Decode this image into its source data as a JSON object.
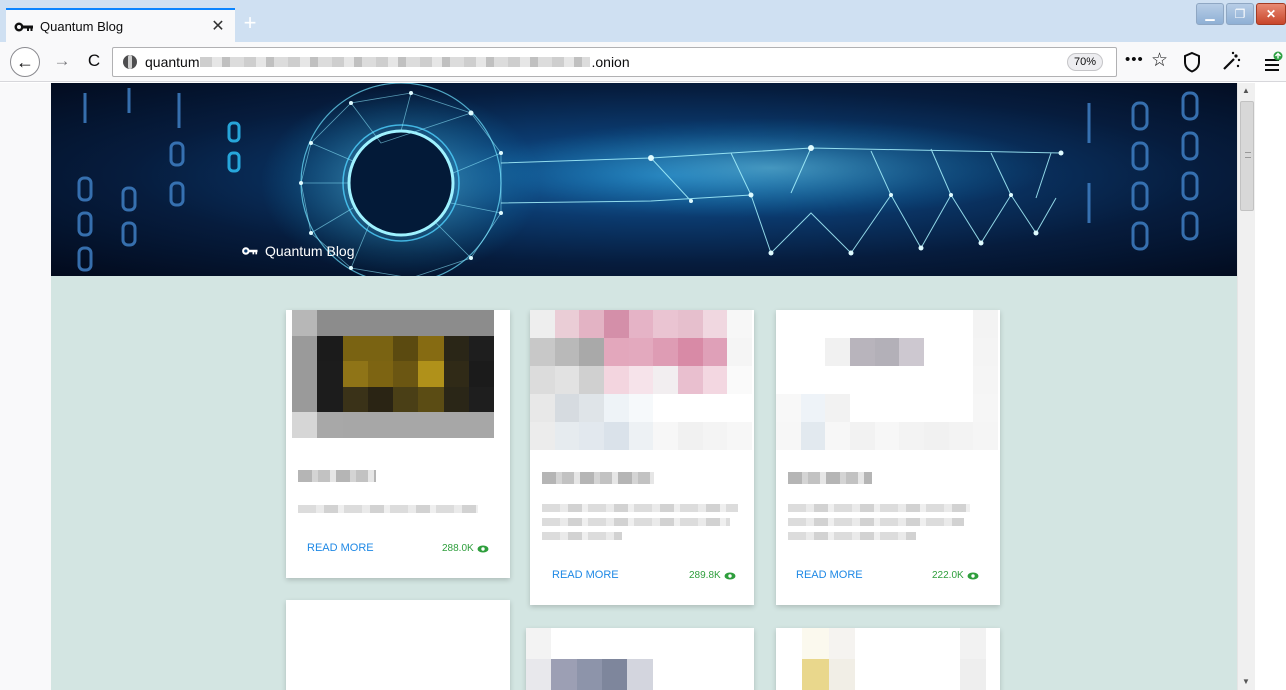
{
  "browser": {
    "tab_title": "Quantum Blog",
    "tab_close": "✕",
    "new_tab": "+",
    "url_prefix": "quantum",
    "url_suffix": ".onion",
    "zoom": "70%",
    "more": "•••",
    "star": "☆",
    "back": "←",
    "forward": "→",
    "reload": "C",
    "window": {
      "minimize": "▁",
      "maximize": "❐",
      "close": "✕"
    },
    "icons": [
      "key-icon",
      "shield-icon",
      "tor-icon",
      "menu-icon",
      "star-icon",
      "more-icon"
    ]
  },
  "page": {
    "hero_title": "Quantum Blog",
    "accent_color": "#1e88e5",
    "views_color": "#2e9e3c",
    "background_color": "#d3e5e2"
  },
  "cards": [
    {
      "read_more": "READ MORE",
      "views": "288.0K"
    },
    {
      "read_more": "READ MORE",
      "views": "289.8K"
    },
    {
      "read_more": "READ MORE",
      "views": "222.0K"
    }
  ]
}
